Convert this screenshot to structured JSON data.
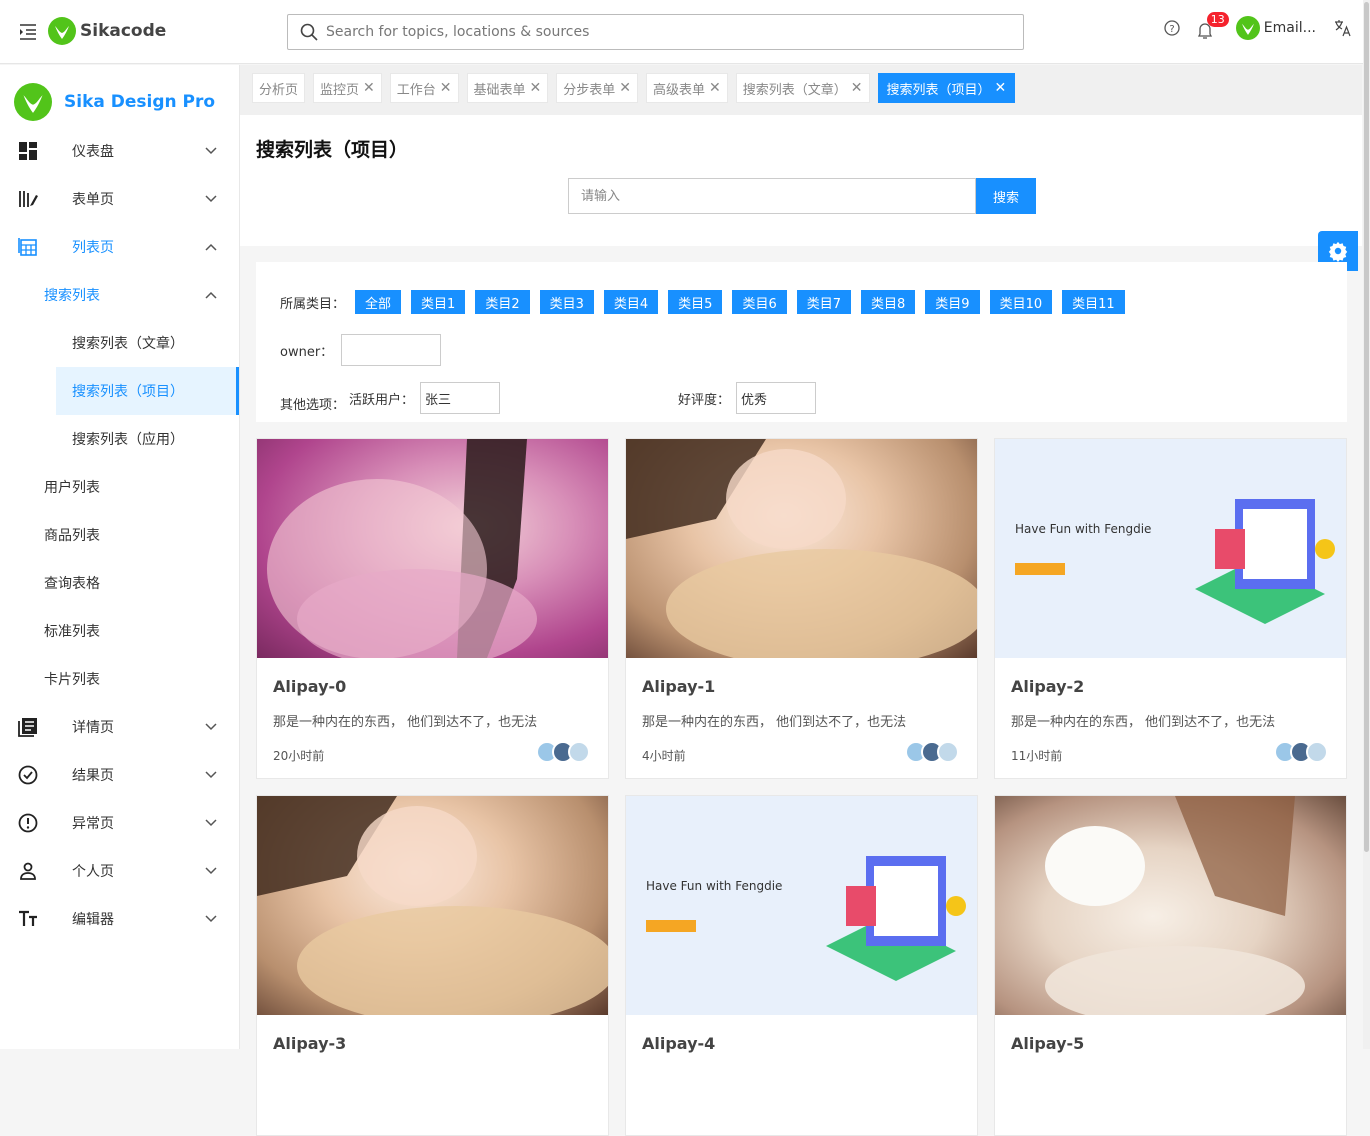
{
  "header": {
    "logo_text": "Sikacode",
    "search_placeholder": "Search for topics, locations & sources",
    "notification_count": "13",
    "user_label": "Email...",
    "accent": "#1890ff"
  },
  "sidebar": {
    "brand": "Sika Design Pro",
    "items": [
      {
        "label": "仪表盘",
        "icon": "dashboard-icon"
      },
      {
        "label": "表单页",
        "icon": "form-icon"
      },
      {
        "label": "列表页",
        "icon": "table-icon"
      },
      {
        "label": "搜索列表"
      },
      {
        "label": "搜索列表（文章）"
      },
      {
        "label": "搜索列表（项目）"
      },
      {
        "label": "搜索列表（应用）"
      },
      {
        "label": "用户列表"
      },
      {
        "label": "商品列表"
      },
      {
        "label": "查询表格"
      },
      {
        "label": "标准列表"
      },
      {
        "label": "卡片列表"
      },
      {
        "label": "详情页",
        "icon": "profile-icon"
      },
      {
        "label": "结果页",
        "icon": "check-circle-icon"
      },
      {
        "label": "异常页",
        "icon": "warning-icon"
      },
      {
        "label": "个人页",
        "icon": "user-icon"
      },
      {
        "label": "编辑器",
        "icon": "text-icon"
      }
    ]
  },
  "tabs": [
    {
      "label": "分析页"
    },
    {
      "label": "监控页"
    },
    {
      "label": "工作台"
    },
    {
      "label": "基础表单"
    },
    {
      "label": "分步表单"
    },
    {
      "label": "高级表单"
    },
    {
      "label": "搜索列表（文章）"
    },
    {
      "label": "搜索列表（项目）"
    }
  ],
  "page": {
    "title": "搜索列表（项目）",
    "search_placeholder": "请输入",
    "search_button": "搜索"
  },
  "filters": {
    "category_label": "所属类目：",
    "categories": [
      "全部",
      "类目1",
      "类目2",
      "类目3",
      "类目4",
      "类目5",
      "类目6",
      "类目7",
      "类目8",
      "类目9",
      "类目10",
      "类目11"
    ],
    "owner_label": "owner：",
    "other_label": "其他选项：",
    "active_user_label": "活跃用户：",
    "active_user_value": "张三",
    "rating_label": "好评度：",
    "rating_value": "优秀"
  },
  "cards": [
    {
      "title": "Alipay-0",
      "desc": "那是一种内在的东西， 他们到达不了，也无法",
      "time": "20小时前",
      "image": "portrait-pink"
    },
    {
      "title": "Alipay-1",
      "desc": "那是一种内在的东西， 他们到达不了，也无法",
      "time": "4小时前",
      "image": "portrait-warm"
    },
    {
      "title": "Alipay-2",
      "desc": "那是一种内在的东西， 他们到达不了，也无法",
      "time": "11小时前",
      "image": "illustration"
    },
    {
      "title": "Alipay-3",
      "desc": "",
      "time": "",
      "image": "portrait-warm"
    },
    {
      "title": "Alipay-4",
      "desc": "",
      "time": "",
      "image": "illustration"
    },
    {
      "title": "Alipay-5",
      "desc": "",
      "time": "",
      "image": "portrait-light"
    }
  ],
  "illustration_text": "Have Fun with Fengdie"
}
